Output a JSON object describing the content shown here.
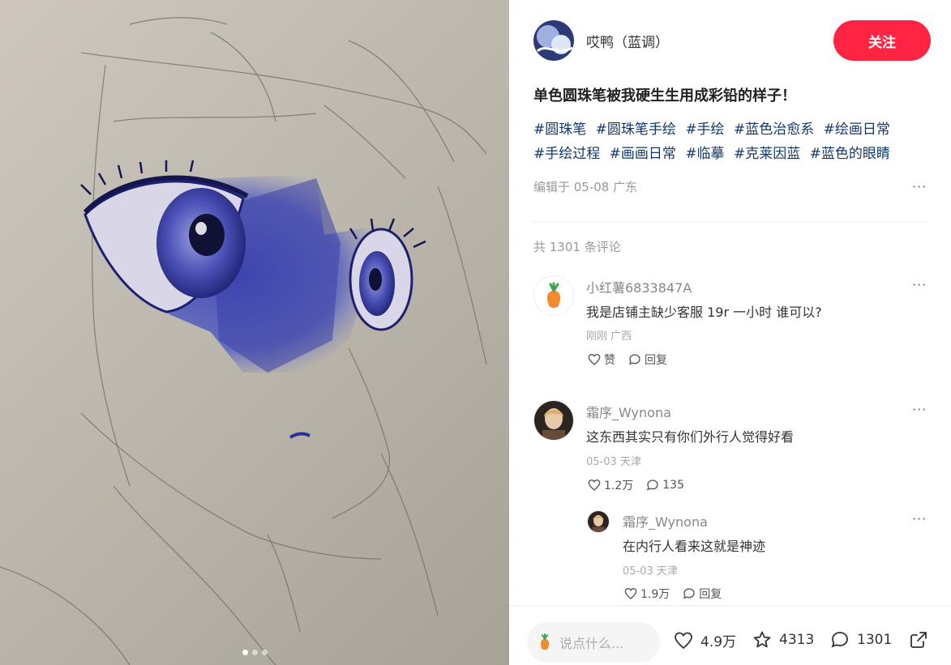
{
  "author": {
    "name": "哎鸭（蓝调）",
    "follow_label": "关注"
  },
  "post": {
    "title": "单色圆珠笔被我硬生生用成彩铅的样子！",
    "tags": [
      "#圆珠笔",
      "#圆珠笔手绘",
      "#手绘",
      "#蓝色治愈系",
      "#绘画日常",
      "#手绘过程",
      "#画画日常",
      "#临摹",
      "#克莱因蓝",
      "#蓝色的眼睛"
    ],
    "meta": "编辑于 05-08 广东",
    "more_label": "···"
  },
  "comments_header": "共 1301 条评论",
  "comments": [
    {
      "name": "小红薯6833847A",
      "text": "我是店铺主缺少客服 19r 一小时 谁可以?",
      "meta": "刚刚 广西",
      "like": "赞",
      "reply": "回复"
    },
    {
      "name": "霜序_Wynona",
      "text": "这东西其实只有你们外行人觉得好看",
      "meta": "05-03 天津",
      "like": "1.2万",
      "reply": "135"
    },
    {
      "name": "霜序_Wynona",
      "text": "在内行人看来这就是神迹",
      "meta": "05-03 天津",
      "like": "1.9万",
      "reply": "回复"
    }
  ],
  "bottom_bar": {
    "input_placeholder": "说点什么...",
    "likes": "4.9万",
    "collects": "4313",
    "comments": "1301"
  },
  "carousel": {
    "count": 3,
    "active": 1
  },
  "colors": {
    "accent": "#ff2442",
    "tag": "#13386c",
    "ink": "#3a3fa8"
  }
}
